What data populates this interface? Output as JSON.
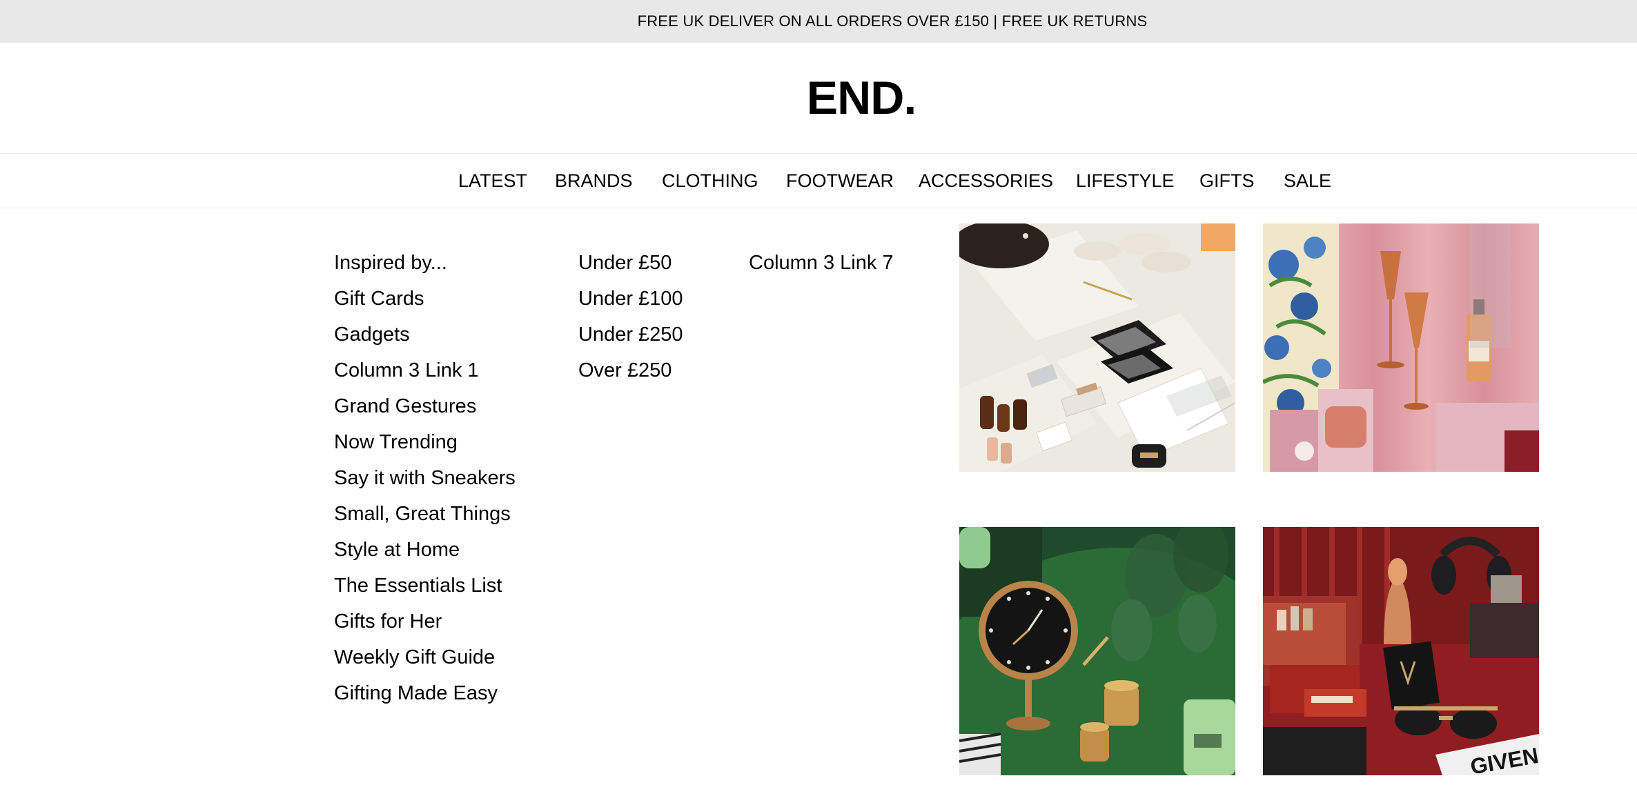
{
  "promo": {
    "text": "FREE UK DELIVER ON ALL ORDERS OVER £150 | FREE UK RETURNS"
  },
  "brand": {
    "logo_text": "END."
  },
  "nav": {
    "items": [
      "LATEST",
      "BRANDS",
      "CLOTHING",
      "FOOTWEAR",
      "ACCESSORIES",
      "LIFESTYLE",
      "GIFTS",
      "SALE"
    ]
  },
  "mega_menu": {
    "column1": [
      "Inspired by...",
      "Gift Cards",
      "Gadgets",
      "Column 3 Link 1",
      "Grand Gestures",
      "Now Trending",
      "Say it with Sneakers",
      "Small, Great Things",
      "Style at Home",
      "The Essentials List",
      "Gifts for Her",
      "Weekly Gift Guide",
      "Gifting Made Easy"
    ],
    "column2": [
      "Under £50",
      "Under £100",
      "Under £250",
      "Over £250"
    ],
    "column3": [
      "Column 3 Link 7"
    ]
  },
  "tiles": {
    "brand_tags": [
      "GIVEN"
    ],
    "colors": {
      "flatlay_bg": "#ece9e1",
      "pink_bg": "#e3a3aa",
      "green_bg": "#1f4a2b",
      "red_bg": "#8f1d22"
    }
  }
}
